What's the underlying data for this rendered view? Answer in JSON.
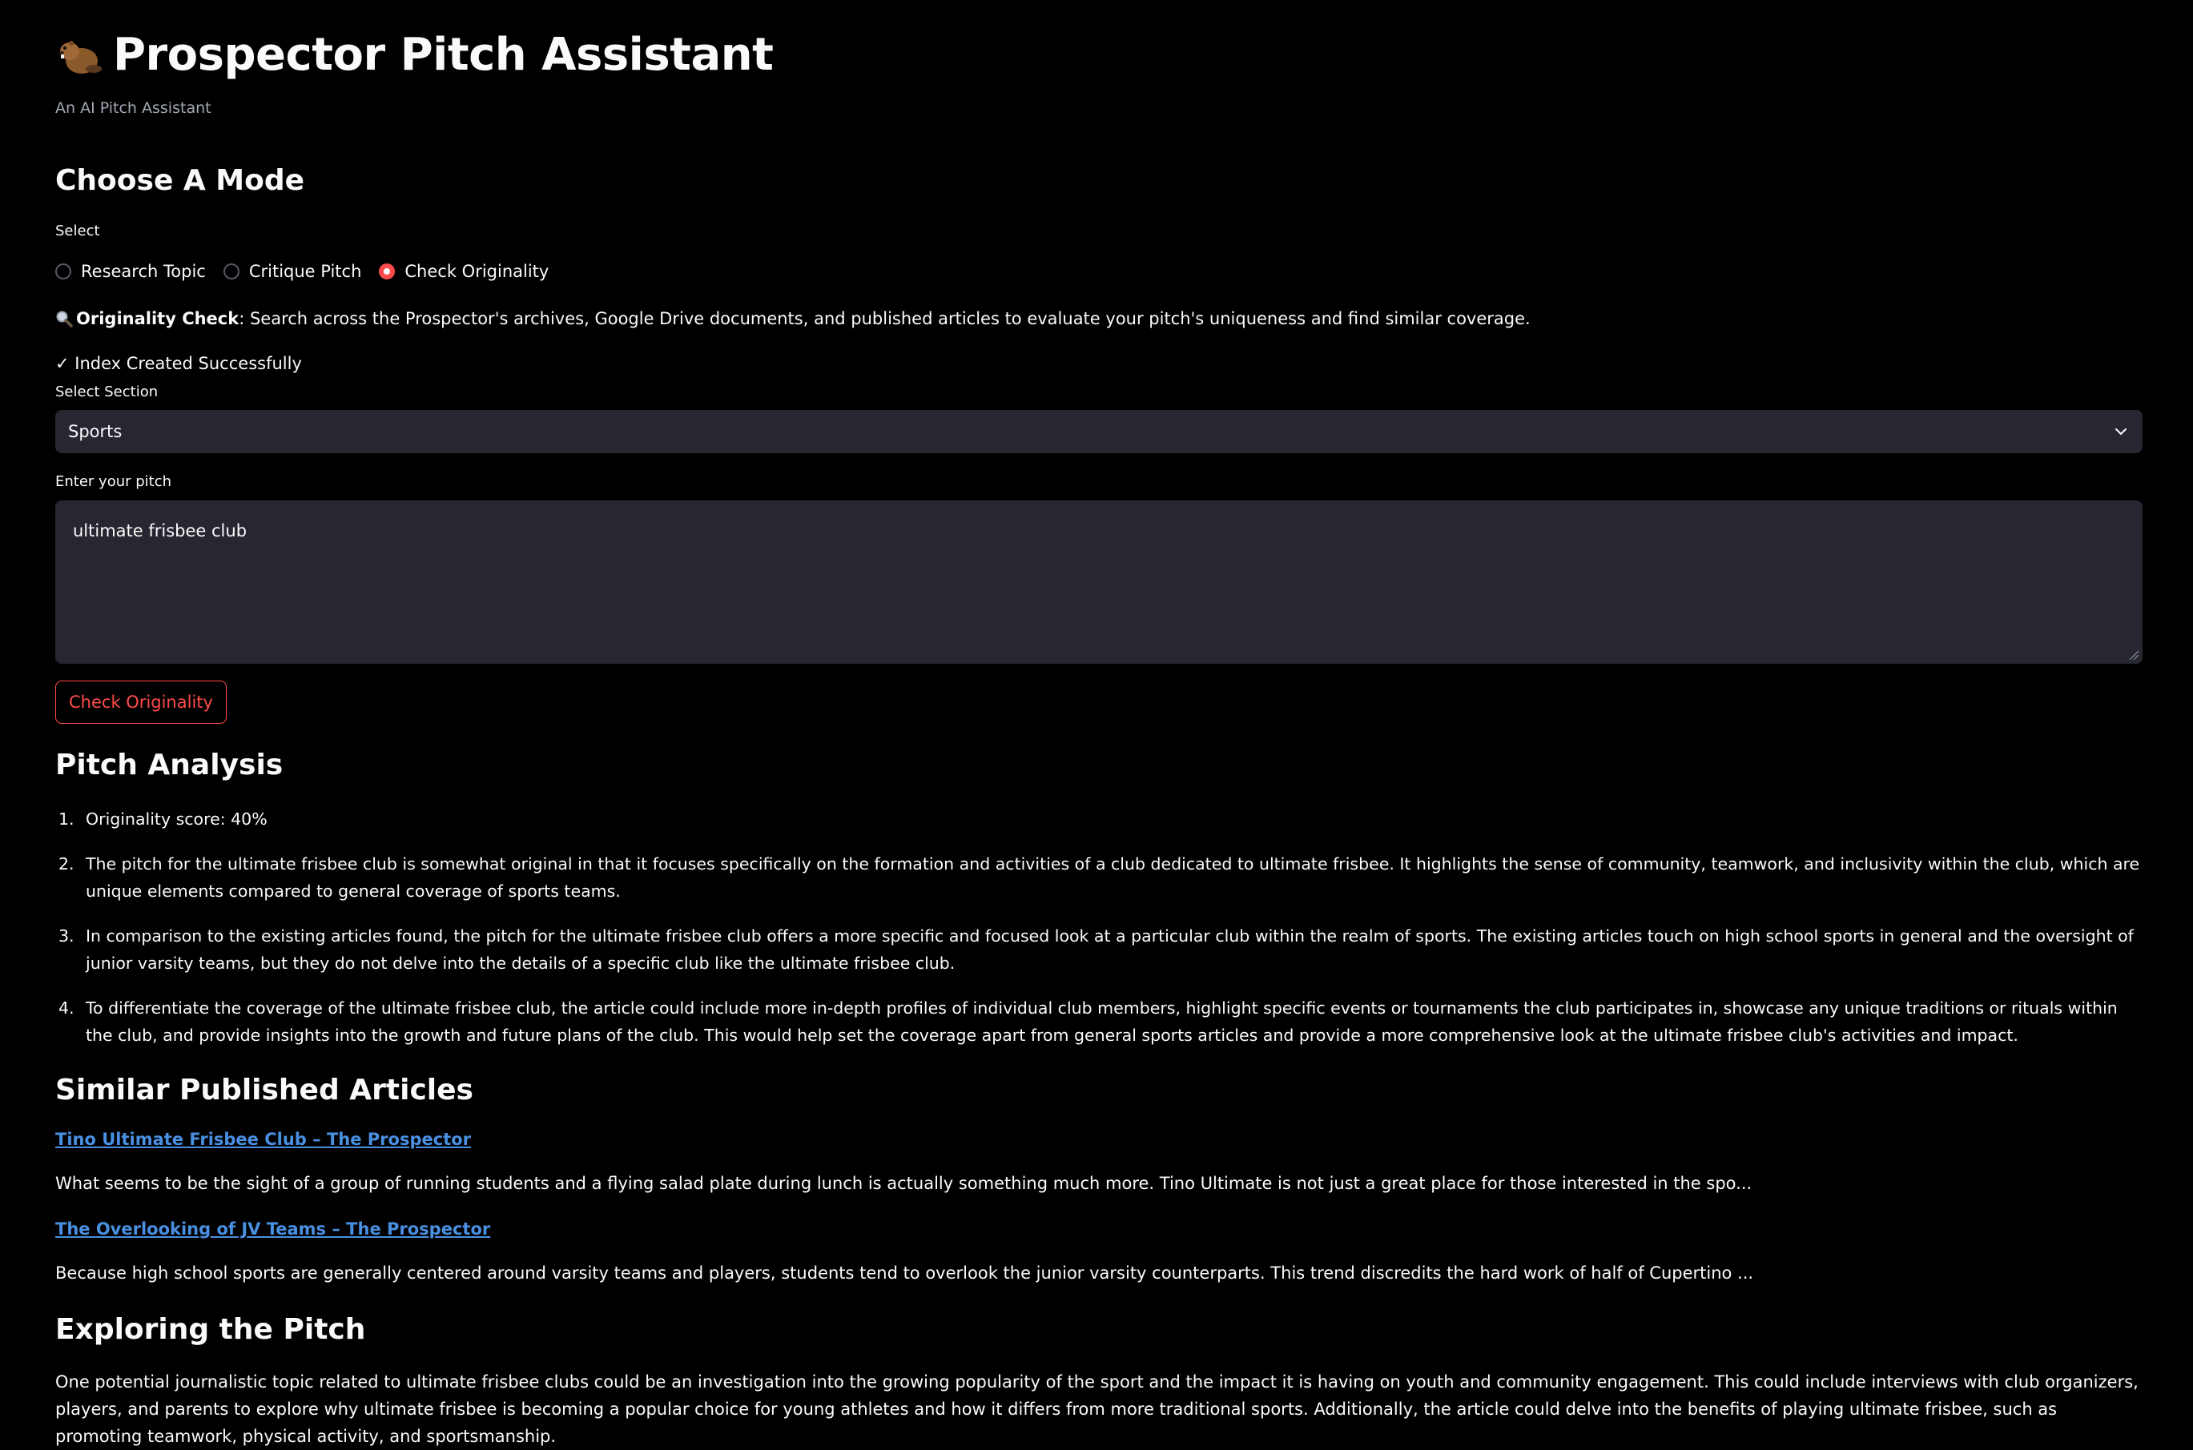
{
  "header": {
    "title": "Prospector Pitch Assistant",
    "caption": "An AI Pitch Assistant",
    "logo_icon": "beaver-icon"
  },
  "mode": {
    "heading": "Choose A Mode",
    "select_label": "Select",
    "options": [
      {
        "label": "Research Topic",
        "checked": false
      },
      {
        "label": "Critique Pitch",
        "checked": false
      },
      {
        "label": "Check Originality",
        "checked": true
      }
    ]
  },
  "info": {
    "icon": "magnifying-glass-icon",
    "bold": "Originality Check",
    "text": ": Search across the Prospector's archives, Google Drive documents, and published articles to evaluate your pitch's uniqueness and find similar coverage."
  },
  "status": {
    "text": "✓ Index Created Successfully"
  },
  "section": {
    "label": "Select Section",
    "value": "Sports",
    "icon": "chevron-down-icon"
  },
  "pitch": {
    "label": "Enter your pitch",
    "value": "ultimate frisbee club"
  },
  "button": {
    "label": "Check Originality"
  },
  "analysis": {
    "heading": "Pitch Analysis",
    "items": [
      {
        "num": "1.",
        "text": "Originality score: 40%"
      },
      {
        "num": "2.",
        "text": "The pitch for the ultimate frisbee club is somewhat original in that it focuses specifically on the formation and activities of a club dedicated to ultimate frisbee. It highlights the sense of community, teamwork, and inclusivity within the club, which are unique elements compared to general coverage of sports teams."
      },
      {
        "num": "3.",
        "text": "In comparison to the existing articles found, the pitch for the ultimate frisbee club offers a more specific and focused look at a particular club within the realm of sports. The existing articles touch on high school sports in general and the oversight of junior varsity teams, but they do not delve into the details of a specific club like the ultimate frisbee club."
      },
      {
        "num": "4.",
        "text": "To differentiate the coverage of the ultimate frisbee club, the article could include more in-depth profiles of individual club members, highlight specific events or tournaments the club participates in, showcase any unique traditions or rituals within the club, and provide insights into the growth and future plans of the club. This would help set the coverage apart from general sports articles and provide a more comprehensive look at the ultimate frisbee club's activities and impact."
      }
    ]
  },
  "similar": {
    "heading": "Similar Published Articles",
    "articles": [
      {
        "title": "Tino Ultimate Frisbee Club – The Prospector",
        "snippet": "What seems to be the sight of a group of running students and a flying salad plate during lunch is actually something much more. Tino Ultimate is not just a great place for those interested in the spo..."
      },
      {
        "title": "The Overlooking of JV Teams – The Prospector",
        "snippet": "Because high school sports are generally centered around varsity teams and players, students tend to overlook the junior varsity counterparts. This trend discredits the hard work of half of Cupertino ..."
      }
    ]
  },
  "exploring": {
    "heading": "Exploring the Pitch",
    "text": "One potential journalistic topic related to ultimate frisbee clubs could be an investigation into the growing popularity of the sport and the impact it is having on youth and community engagement. This could include interviews with club organizers, players, and parents to explore why ultimate frisbee is becoming a popular choice for young athletes and how it differs from more traditional sports. Additionally, the article could delve into the benefits of playing ultimate frisbee, such as promoting teamwork, physical activity, and sportsmanship."
  },
  "colors": {
    "background": "#000000",
    "text": "#fafafa",
    "accent": "#ff4b4b",
    "input_bg": "#262730",
    "link": "#4a90e2"
  }
}
